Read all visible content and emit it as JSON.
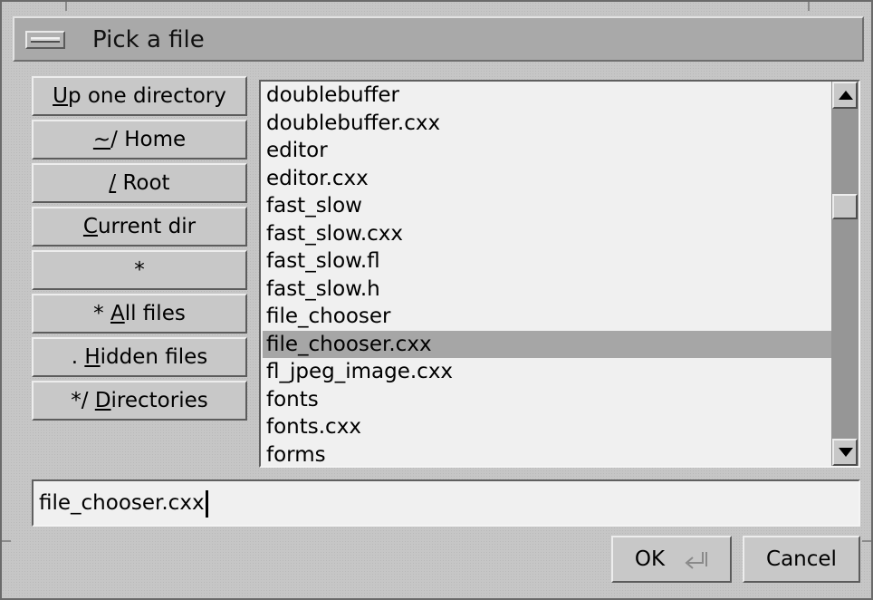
{
  "window": {
    "title": "Pick a file"
  },
  "sidebar": {
    "buttons": [
      {
        "prefix": "",
        "underline": "U",
        "rest": "p one directory"
      },
      {
        "prefix": "",
        "underline": "~",
        "rest": "/ Home"
      },
      {
        "prefix": "",
        "underline": "/",
        "rest": " Root"
      },
      {
        "prefix": "",
        "underline": "C",
        "rest": "urrent dir"
      },
      {
        "prefix": "*",
        "underline": "",
        "rest": ""
      },
      {
        "prefix": "* ",
        "underline": "A",
        "rest": "ll files"
      },
      {
        "prefix": ". ",
        "underline": "H",
        "rest": "idden files"
      },
      {
        "prefix": "*/ ",
        "underline": "D",
        "rest": "irectories"
      }
    ]
  },
  "browser": {
    "items": [
      "doublebuffer",
      "doublebuffer.cxx",
      "editor",
      "editor.cxx",
      "fast_slow",
      "fast_slow.cxx",
      "fast_slow.fl",
      "fast_slow.h",
      "file_chooser",
      "file_chooser.cxx",
      "fl_jpeg_image.cxx",
      "fonts",
      "fonts.cxx",
      "forms"
    ],
    "selected": "file_chooser.cxx"
  },
  "filename": {
    "value": "file_chooser.cxx"
  },
  "buttons": {
    "ok_label": "OK",
    "ok_icon": "return-key-icon",
    "cancel_label": "Cancel"
  }
}
